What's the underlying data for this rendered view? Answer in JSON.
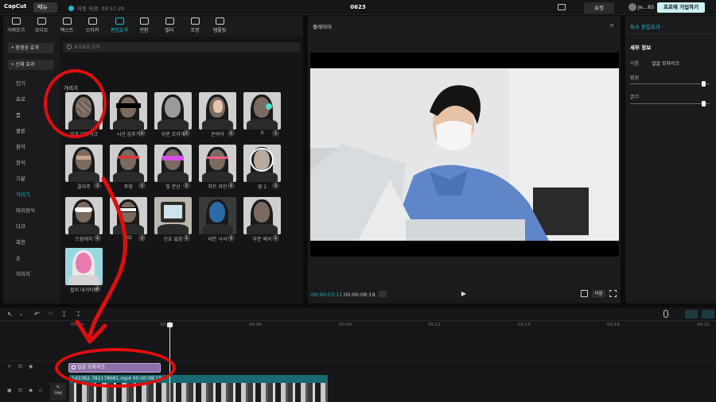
{
  "app": {
    "logo": "CapCut",
    "menu_label": "메뉴",
    "autosave": "자동 저장: 03:57:20",
    "project_title": "0623",
    "shortcut_label": "숏컷",
    "user_name": "Je...85",
    "pro_label": "프로에 가입하기"
  },
  "tool_tabs": [
    {
      "label": "가져오기"
    },
    {
      "label": "오디오"
    },
    {
      "label": "텍스트"
    },
    {
      "label": "스티커"
    },
    {
      "label": "편집효과"
    },
    {
      "label": "전환"
    },
    {
      "label": "필터"
    },
    {
      "label": "조정"
    },
    {
      "label": "템플릿"
    }
  ],
  "sidebar": {
    "heads": [
      "• 동영상 효과",
      "• 신체 효과"
    ],
    "items": [
      "인기",
      "프로",
      "몸",
      "클론",
      "환각",
      "장식",
      "기분",
      "가리기",
      "머리장식",
      "다크",
      "회전",
      "손",
      "이미지"
    ]
  },
  "effects": {
    "search_placeholder": "효과효과 검색",
    "section_title": "가리기",
    "cards": [
      {
        "label": "얼굴 모자이크"
      },
      {
        "label": "시선 감추기"
      },
      {
        "label": "부분 흐리게"
      },
      {
        "label": "손바닥"
      },
      {
        "label": "X"
      },
      {
        "label": "콜라주"
      },
      {
        "label": "투링"
      },
      {
        "label": "빛 분산"
      },
      {
        "label": "하트 라인"
      },
      {
        "label": "꿈 1"
      },
      {
        "label": "드림캐처"
      },
      {
        "label": "3D"
      },
      {
        "label": "신호 없음"
      },
      {
        "label": "네온 낙서"
      },
      {
        "label": "부분 왜곡"
      },
      {
        "label": "컬러 네거티브"
      }
    ]
  },
  "player": {
    "title": "플레이어",
    "tc_current": "00:00:03:11",
    "tc_total": "00:00:08:19",
    "ratio_label": "비율"
  },
  "props": {
    "title": "특수 편집효과",
    "section": "세부 정보",
    "name_label": "이름",
    "name_value": "얼굴 모자이크",
    "range_label": "범위",
    "thickness_label": "굵기",
    "range_value": 0.95,
    "thickness_value": 0.95
  },
  "timeline": {
    "ticks": [
      "00:00",
      "00:03",
      "00:06",
      "00:09",
      "00:12",
      "00:15",
      "00:18",
      "00:21"
    ],
    "effect_clip": "얼굴 모자이크",
    "video_clip": "143382-782178681.mp4  00:00:08:19",
    "cover_label": "커버"
  },
  "colors": {
    "accent": "#1fb8c9",
    "annotation": "#e10d0d",
    "effect_clip": "#8e6fa9",
    "video_clip": "#176a72"
  }
}
